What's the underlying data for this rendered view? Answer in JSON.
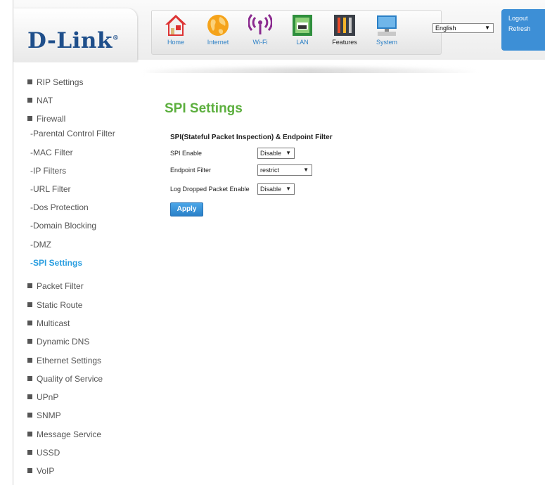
{
  "brand": {
    "logo_text": "D-Link",
    "accent": "#3d8fd6",
    "title_color": "#5caf3e",
    "active_color": "#2a9ee0"
  },
  "nav": [
    {
      "label": "Home",
      "icon": "house-icon"
    },
    {
      "label": "Internet",
      "icon": "globe-icon"
    },
    {
      "label": "Wi-Fi",
      "icon": "wifi-icon"
    },
    {
      "label": "LAN",
      "icon": "lan-port-icon"
    },
    {
      "label": "Features",
      "icon": "tools-icon"
    },
    {
      "label": "System",
      "icon": "computer-icon"
    }
  ],
  "language": {
    "selected": "English"
  },
  "auth": {
    "logout": "Logout",
    "refresh": "Refresh"
  },
  "sidebar": [
    {
      "label": "RIP Settings",
      "type": "main"
    },
    {
      "label": "NAT",
      "type": "main"
    },
    {
      "label": "Firewall",
      "type": "main"
    },
    {
      "label": "-Parental Control Filter",
      "type": "sub"
    },
    {
      "label": "-MAC Filter",
      "type": "sub"
    },
    {
      "label": "-IP Filters",
      "type": "sub"
    },
    {
      "label": "-URL Filter",
      "type": "sub"
    },
    {
      "label": "-Dos Protection",
      "type": "sub"
    },
    {
      "label": "-Domain Blocking",
      "type": "sub"
    },
    {
      "label": "-DMZ",
      "type": "sub"
    },
    {
      "label": "-SPI Settings",
      "type": "active"
    },
    {
      "label": "Packet Filter",
      "type": "main"
    },
    {
      "label": "Static Route",
      "type": "main"
    },
    {
      "label": "Multicast",
      "type": "main"
    },
    {
      "label": "Dynamic DNS",
      "type": "main"
    },
    {
      "label": "Ethernet Settings",
      "type": "main"
    },
    {
      "label": "Quality of Service",
      "type": "main"
    },
    {
      "label": "UPnP",
      "type": "main"
    },
    {
      "label": "SNMP",
      "type": "main"
    },
    {
      "label": "Message Service",
      "type": "main"
    },
    {
      "label": "USSD",
      "type": "main"
    },
    {
      "label": "VoIP",
      "type": "main"
    }
  ],
  "page": {
    "title": "SPI Settings",
    "section": "SPI(Stateful Packet Inspection) & Endpoint Filter",
    "fields": [
      {
        "label": "SPI Enable",
        "value": "Disable"
      },
      {
        "label": "Endpoint Filter",
        "value": "restrict"
      },
      {
        "label": "Log Dropped Packet Enable",
        "value": "Disable"
      }
    ],
    "apply_label": "Apply"
  }
}
